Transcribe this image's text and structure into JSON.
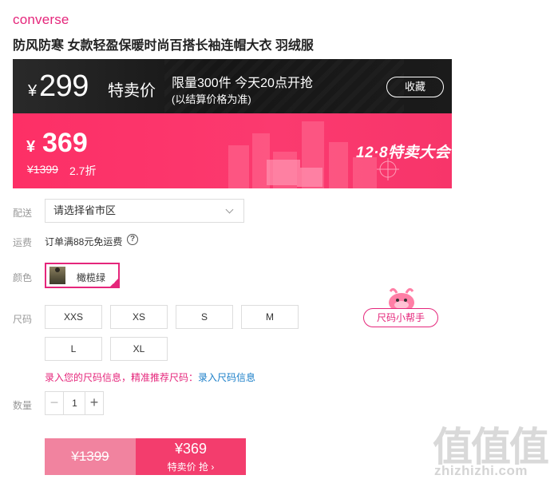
{
  "brand": "converse",
  "title": "防风防寒 女款轻盈保暖时尚百搭长袖连帽大衣 羽绒服",
  "flash": {
    "currency": "¥",
    "price": "299",
    "tag": "特卖价",
    "line1": "限量300件 今天20点开抢",
    "line2": "(以结算价格为准)",
    "favorite": "收藏"
  },
  "sale": {
    "currency": "¥",
    "price": "369",
    "original": "¥1399",
    "discount": "2.7折",
    "event": "12·8特卖大会"
  },
  "delivery": {
    "label": "配送",
    "placeholder": "请选择省市区"
  },
  "shipping": {
    "label": "运费",
    "text": "订单满88元免运费",
    "help": "?"
  },
  "color": {
    "label": "颜色",
    "selected": "橄榄绿"
  },
  "size": {
    "label": "尺码",
    "options": [
      "XXS",
      "XS",
      "S",
      "M",
      "L",
      "XL"
    ],
    "helper": "尺码小帮手",
    "info_text": "录入您的尺码信息，精准推荐尺码：",
    "info_link": "录入尺码信息"
  },
  "quantity": {
    "label": "数量",
    "value": "1",
    "minus": "−",
    "plus": "+"
  },
  "buy": {
    "original": "¥1399",
    "price": "¥369",
    "action": "特卖价 抢 ›"
  },
  "watermark": {
    "glyphs": "值值值",
    "url": "zhizhizhi.com"
  },
  "colors": {
    "accent": "#e5267b",
    "sale_bg": "#fd2f66",
    "dark_bg": "#1b1b1b",
    "link": "#1b7fc9",
    "buy_sale": "#f33d6d",
    "buy_orig": "#f1839f"
  }
}
